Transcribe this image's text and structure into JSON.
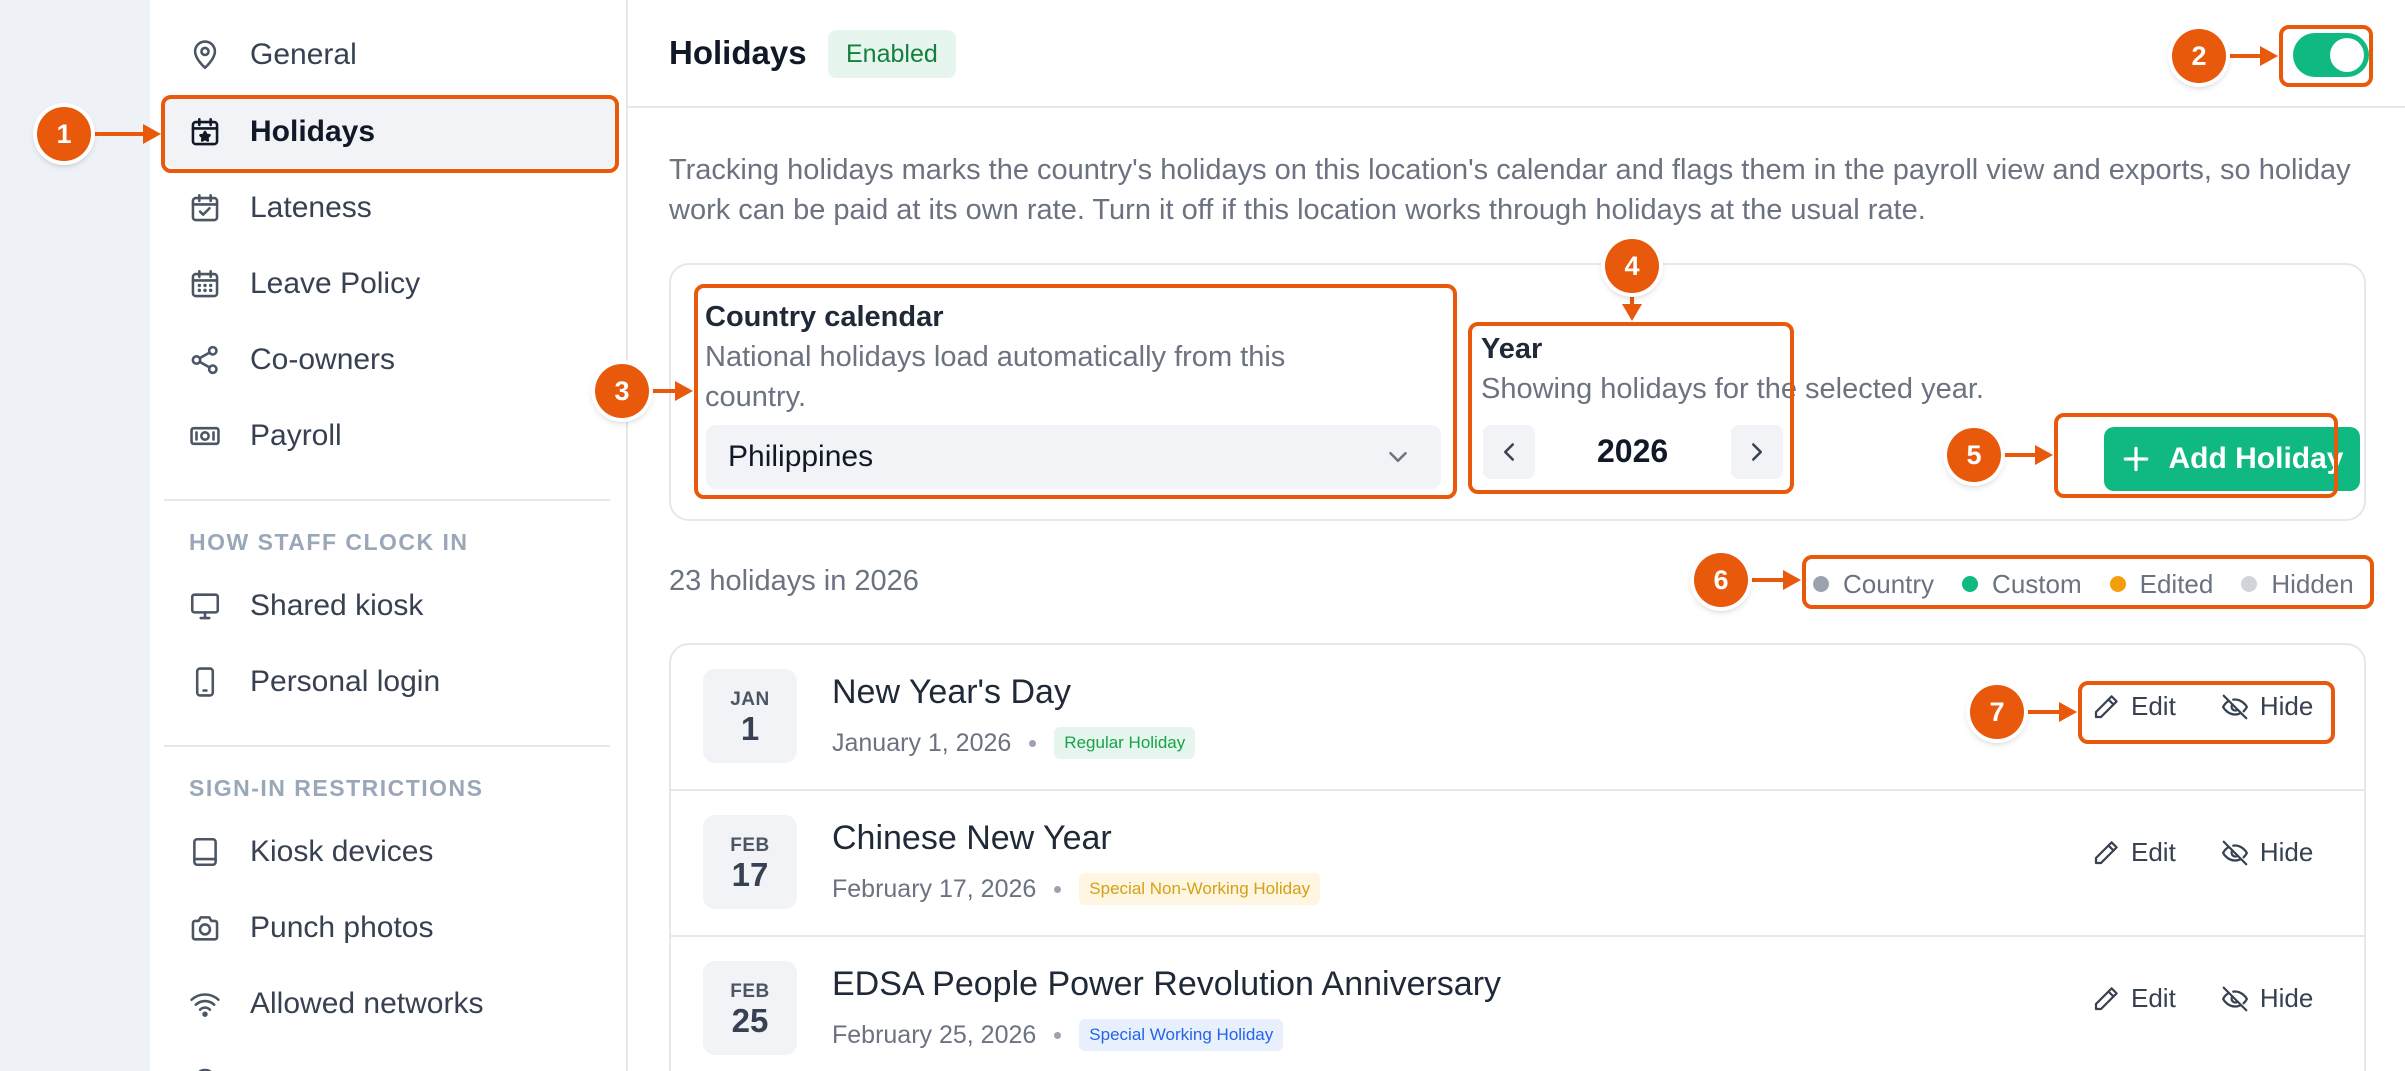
{
  "sidebar": {
    "items": [
      {
        "label": "General",
        "icon": "location-pin-icon"
      },
      {
        "label": "Holidays",
        "icon": "calendar-star-icon",
        "active": true
      },
      {
        "label": "Lateness",
        "icon": "calendar-check-icon"
      },
      {
        "label": "Leave Policy",
        "icon": "calendar-grid-icon"
      },
      {
        "label": "Co-owners",
        "icon": "share-icon"
      },
      {
        "label": "Payroll",
        "icon": "banknote-icon"
      }
    ],
    "section_clock": "HOW STAFF CLOCK IN",
    "clock_items": [
      {
        "label": "Shared kiosk",
        "icon": "monitor-icon"
      },
      {
        "label": "Personal login",
        "icon": "phone-icon"
      }
    ],
    "section_restrictions": "SIGN-IN RESTRICTIONS",
    "restriction_items": [
      {
        "label": "Kiosk devices",
        "icon": "tablet-icon"
      },
      {
        "label": "Punch photos",
        "icon": "camera-icon"
      },
      {
        "label": "Allowed networks",
        "icon": "wifi-icon"
      }
    ]
  },
  "header": {
    "title": "Holidays",
    "status": "Enabled",
    "toggle_on": true
  },
  "description": "Tracking holidays marks the country's holidays on this location's calendar and flags them in the payroll view and exports, so holiday work can be paid at its own rate. Turn it off if this location works through holidays at the usual rate.",
  "country": {
    "label": "Country calendar",
    "help": "National holidays load automatically from this country.",
    "value": "Philippines"
  },
  "year": {
    "label": "Year",
    "help": "Showing holidays for the selected year.",
    "value": "2026"
  },
  "add_button": "Add Holiday",
  "count_text": "23 holidays in 2026",
  "legend": [
    {
      "label": "Country",
      "color": "#9ca3af"
    },
    {
      "label": "Custom",
      "color": "#10b981"
    },
    {
      "label": "Edited",
      "color": "#f59e0b"
    },
    {
      "label": "Hidden",
      "color": "#d1d5db"
    }
  ],
  "holidays": [
    {
      "month": "JAN",
      "day": "1",
      "name": "New Year's Day",
      "date": "January 1, 2026",
      "type": "Regular Holiday",
      "type_color": "#16a34a",
      "type_bg": "#e6f6ee"
    },
    {
      "month": "FEB",
      "day": "17",
      "name": "Chinese New Year",
      "date": "February 17, 2026",
      "type": "Special Non-Working Holiday",
      "type_color": "#d4a017",
      "type_bg": "#fef6e0"
    },
    {
      "month": "FEB",
      "day": "25",
      "name": "EDSA People Power Revolution Anniversary",
      "date": "February 25, 2026",
      "type": "Special Working Holiday",
      "type_color": "#2563eb",
      "type_bg": "#e8f0fe"
    }
  ],
  "actions": {
    "edit": "Edit",
    "hide": "Hide"
  },
  "callouts": [
    "1",
    "2",
    "3",
    "4",
    "5",
    "6",
    "7"
  ],
  "accent_color": "#e8590c"
}
